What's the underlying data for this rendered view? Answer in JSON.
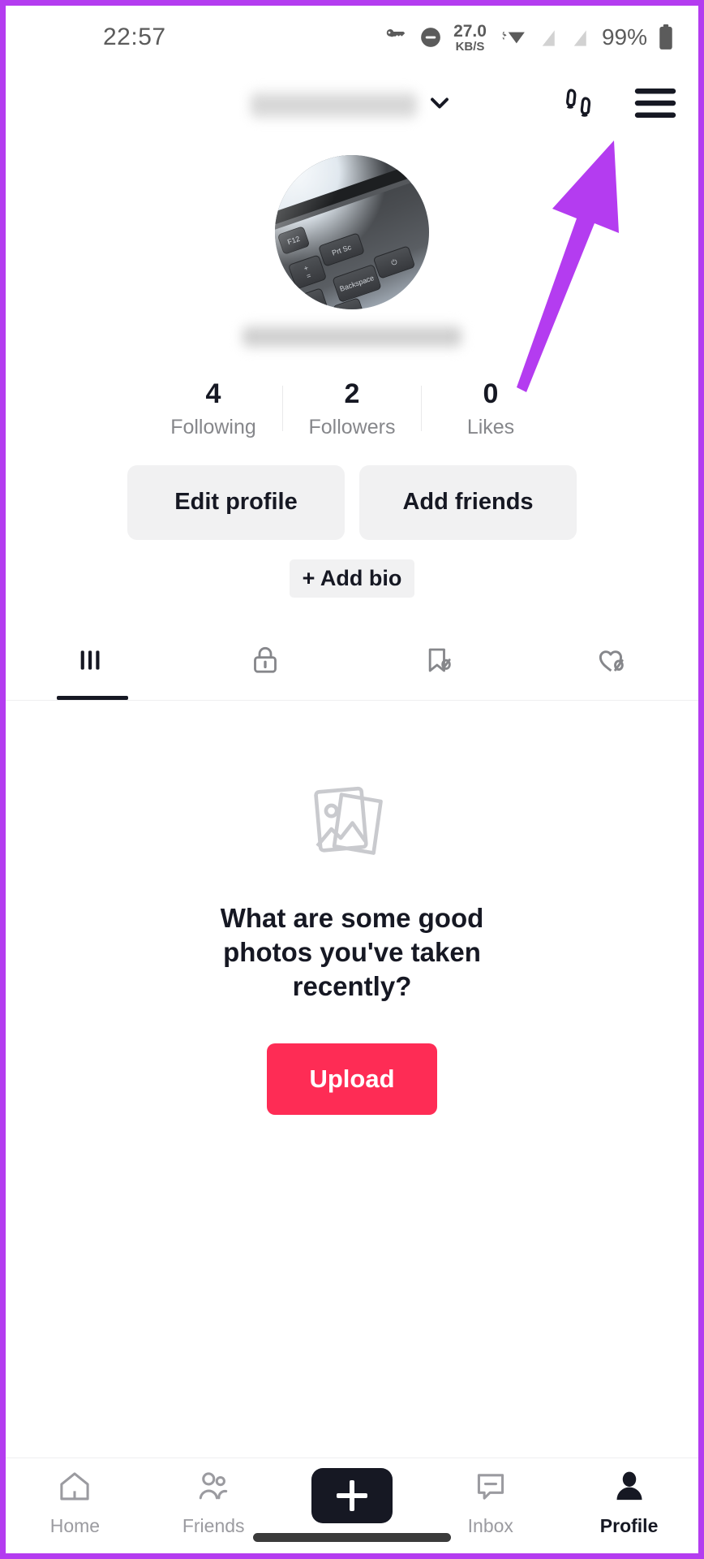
{
  "annotation": {
    "color": "#b43cf0",
    "arrow_name": "arrow-pointing-to-menu-button"
  },
  "status_bar": {
    "time": "22:57",
    "network_speed_value": "27.0",
    "network_speed_unit": "KB/S",
    "battery_percent": "99%",
    "icons": [
      "vpn-key-icon",
      "do-not-disturb-icon",
      "network-speed-indicator",
      "wifi-icon",
      "sim1-no-signal-icon",
      "sim2-no-signal-icon",
      "battery-icon"
    ]
  },
  "header": {
    "username": "",
    "username_hidden": true,
    "chevron_icon": "chevron-down-icon",
    "footprints_icon": "footprints-icon",
    "menu_icon": "hamburger-menu-icon"
  },
  "profile": {
    "avatar_alt": "laptop-keyboard-photo",
    "handle": "",
    "handle_hidden": true,
    "stats": [
      {
        "count": "4",
        "label": "Following"
      },
      {
        "count": "2",
        "label": "Followers"
      },
      {
        "count": "0",
        "label": "Likes"
      }
    ],
    "edit_profile_label": "Edit profile",
    "add_friends_label": "Add friends",
    "add_bio_label": "+ Add bio"
  },
  "content_tabs": [
    {
      "name": "posts-tab",
      "icon": "grid-bars-icon",
      "active": true
    },
    {
      "name": "private-tab",
      "icon": "lock-icon",
      "active": false
    },
    {
      "name": "reposts-tab",
      "icon": "bookmark-slash-icon",
      "active": false
    },
    {
      "name": "liked-tab",
      "icon": "heart-slash-icon",
      "active": false
    }
  ],
  "empty_state": {
    "icon": "stacked-photos-icon",
    "title": "What are some good photos you've taken recently?",
    "upload_label": "Upload",
    "upload_color": "#fe2c55"
  },
  "bottom_nav": [
    {
      "label": "Home",
      "icon": "home-icon",
      "active": false
    },
    {
      "label": "Friends",
      "icon": "friends-icon",
      "active": false
    },
    {
      "label": "",
      "icon": "create-plus-icon",
      "active": false
    },
    {
      "label": "Inbox",
      "icon": "inbox-icon",
      "active": false
    },
    {
      "label": "Profile",
      "icon": "profile-person-icon",
      "active": true
    }
  ]
}
